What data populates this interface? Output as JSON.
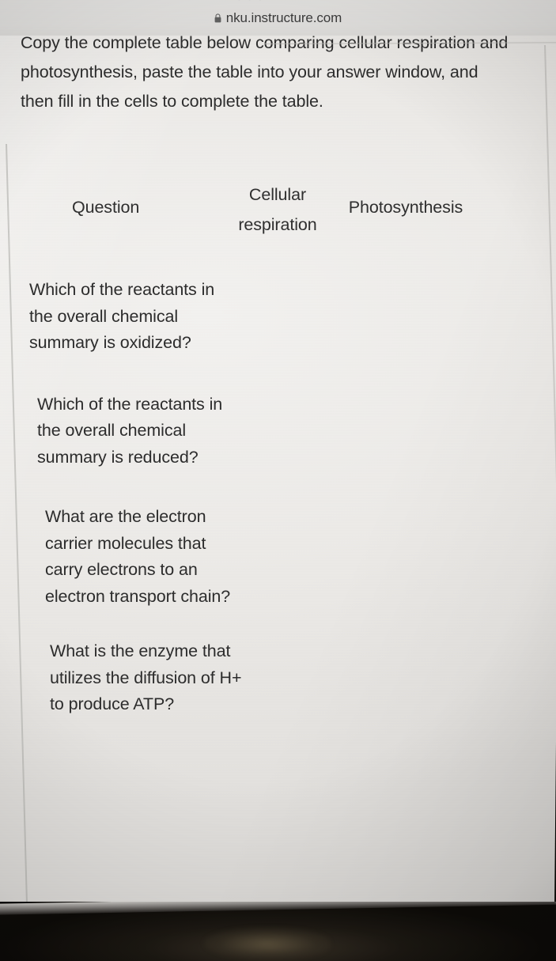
{
  "browser": {
    "lock_icon": "lock-icon",
    "url": "nku.instructure.com",
    "clipped_text_above": "· · ·"
  },
  "page": {
    "instructions": "Copy the complete table below comparing cellular respiration and photosynthesis, paste the table into your answer window, and then fill in the cells to complete the table."
  },
  "table": {
    "headers": {
      "question": "Question",
      "cellular_respiration": "Cellular respiration",
      "cellular_respiration_line1": "Cellular",
      "cellular_respiration_line2": "respiration",
      "photosynthesis": "Photosynthesis"
    },
    "rows": [
      {
        "question": "Which of the reactants in the overall chemical summary is oxidized?",
        "cellular_respiration": "",
        "photosynthesis": ""
      },
      {
        "question": "Which of the reactants in the overall chemical summary is reduced?",
        "cellular_respiration": "",
        "photosynthesis": ""
      },
      {
        "question": "What are the electron carrier molecules that carry electrons to an electron transport chain?",
        "cellular_respiration": "",
        "photosynthesis": ""
      },
      {
        "question": "What is the enzyme that utilizes the diffusion of H+ to produce ATP?",
        "cellular_respiration": "",
        "photosynthesis": ""
      }
    ]
  },
  "colors": {
    "page_background": "#eceae7",
    "text": "#2c2c2c",
    "url_bar_background": "#e2e1df",
    "table_border": "#b9b8b4",
    "bezel": "#0d0b08"
  }
}
